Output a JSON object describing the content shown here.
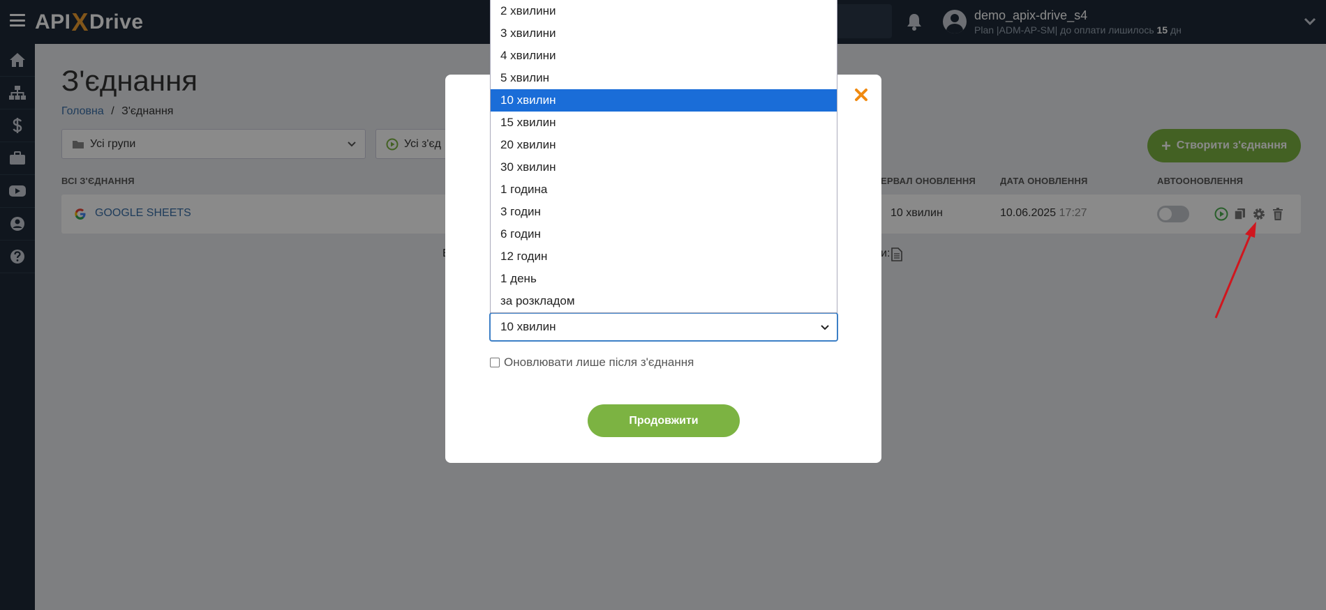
{
  "brand": {
    "logo_prefix": "API",
    "logo_x": "X",
    "logo_suffix": "Drive"
  },
  "header": {
    "username": "demo_apix-drive_s4",
    "plan_text": "Plan |ADM-AP-SM| до оплати лишилось",
    "plan_days": "15",
    "plan_unit": "дн"
  },
  "page": {
    "title": "З'єднання",
    "breadcrumb_home": "Головна",
    "breadcrumb_sep": "/",
    "breadcrumb_current": "З'єднання",
    "filter_groups": "Усі групи",
    "filter_status": "Усі з'єд",
    "create_button": "Створити з'єднання"
  },
  "table": {
    "headers": {
      "all": "Всі з'єднання",
      "interval": "ервал оновлення",
      "date": "Дата оновлення",
      "auto": "Автооновлення"
    },
    "rows": [
      {
        "name": "GOOGLE SHEETS",
        "interval": "10 хвилин",
        "date": "10.06.2025",
        "time": "17:27",
        "autoupdate": false
      }
    ],
    "below_left": "Е",
    "below_right": "и:"
  },
  "modal": {
    "selected_value": "10 хвилин",
    "checkbox_label": "Оновлювати лише після з'єднання",
    "continue_button": "Продовжити"
  },
  "dropdown": {
    "selected_index": 4,
    "options": [
      "2 хвилини",
      "3 хвилини",
      "4 хвилини",
      "5 хвилин",
      "10 хвилин",
      "15 хвилин",
      "20 хвилин",
      "30 хвилин",
      "1 година",
      "3 годин",
      "6 годин",
      "12 годин",
      "1 день",
      "за розкладом"
    ]
  },
  "colors": {
    "topbar": "#1e2a38",
    "accent_green": "#7cb342",
    "link_blue": "#3a6fa8",
    "selected_blue": "#1a6dd8",
    "close_orange": "#f08a10",
    "arrow_red": "#d0161e"
  },
  "icons": {
    "sidebar": [
      "home-icon",
      "sitemap-icon",
      "dollar-icon",
      "briefcase-icon",
      "youtube-icon",
      "user-circle-icon",
      "question-icon"
    ],
    "row_actions": [
      "play-icon",
      "copy-icon",
      "gear-icon",
      "trash-icon"
    ]
  }
}
